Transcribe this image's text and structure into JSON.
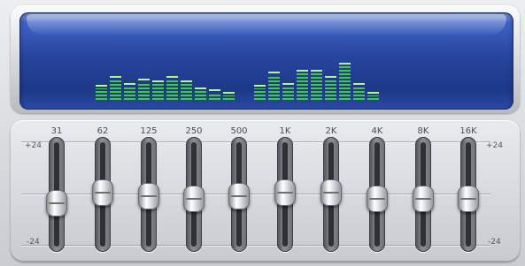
{
  "visualizer": {
    "group1": [
      0.25,
      0.45,
      0.3,
      0.4,
      0.35,
      0.45,
      0.35,
      0.2,
      0.15,
      0.1
    ],
    "group2": [
      0.25,
      0.55,
      0.3,
      0.6,
      0.6,
      0.45,
      0.75,
      0.3,
      0.1
    ],
    "bar_color": "#3ccc3c",
    "screen_color": "#27459e"
  },
  "equalizer": {
    "gain_max_label": "+24",
    "gain_min_label": "-24",
    "gain_range_db": [
      -24,
      24
    ],
    "bands": [
      {
        "label": "31",
        "gain_db": -6
      },
      {
        "label": "62",
        "gain_db": 1
      },
      {
        "label": "125",
        "gain_db": -1
      },
      {
        "label": "250",
        "gain_db": -3
      },
      {
        "label": "500",
        "gain_db": -1
      },
      {
        "label": "1K",
        "gain_db": 1
      },
      {
        "label": "2K",
        "gain_db": 1
      },
      {
        "label": "4K",
        "gain_db": -3
      },
      {
        "label": "8K",
        "gain_db": -3
      },
      {
        "label": "16K",
        "gain_db": -3
      }
    ]
  }
}
